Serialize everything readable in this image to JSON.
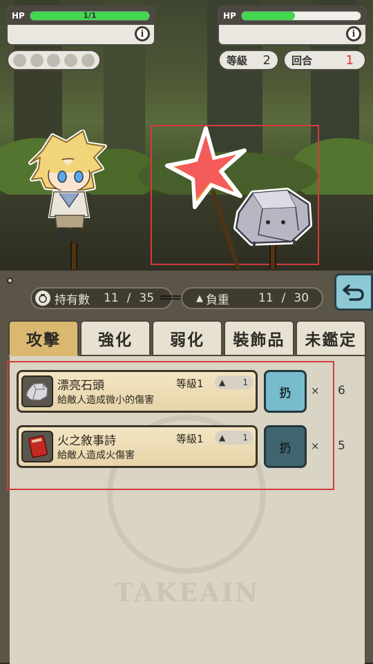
{
  "player_hud": {
    "hp_label": "HP",
    "hp_text": "1/1",
    "hp_fraction": 1.0,
    "info_label": "i",
    "action_dots": 5
  },
  "enemy_hud": {
    "hp_label": "HP",
    "hp_fraction": 0.45,
    "info_label": "i",
    "level_label": "等級",
    "level_value": "2",
    "turn_label": "回合",
    "turn_value": "1"
  },
  "inventory": {
    "holding_label": "持有數",
    "holding_current": "11",
    "holding_sep": "/",
    "holding_max": "35",
    "weight_label": "負重",
    "weight_current": "11",
    "weight_sep": "/",
    "weight_max": "30",
    "tabs": [
      {
        "label": "攻擊",
        "active": true
      },
      {
        "label": "強化",
        "active": false
      },
      {
        "label": "弱化",
        "active": false
      },
      {
        "label": "裝飾品",
        "active": false
      },
      {
        "label": "未鑑定",
        "active": false
      }
    ],
    "items": [
      {
        "name": "漂亮石頭",
        "level": "等級1",
        "weight": "1",
        "desc": "給敵人造成微小的傷害",
        "action": "扔",
        "times": "×",
        "count": "6",
        "icon": "stone-icon",
        "enabled": true
      },
      {
        "name": "火之敘事詩",
        "level": "等級1",
        "weight": "1",
        "desc": "給敵人造成火傷害",
        "action": "扔",
        "times": "×",
        "count": "5",
        "icon": "red-book-icon",
        "enabled": false
      }
    ],
    "watermark": "TAKEAIN"
  },
  "colors": {
    "hp_green": "#43d64f",
    "turn_red": "#e02b2b",
    "active_tab": "#dab870",
    "throw_button": "#77bccc",
    "highlight_red": "#d43b3b"
  }
}
